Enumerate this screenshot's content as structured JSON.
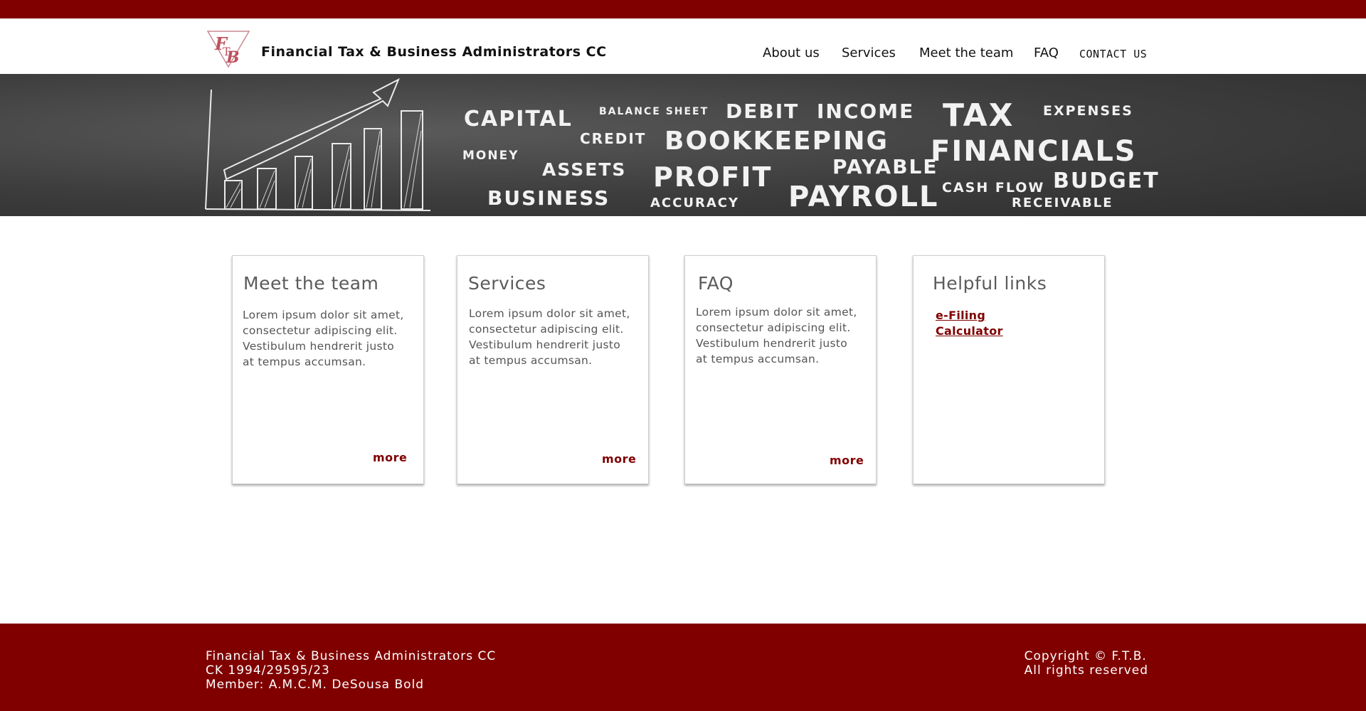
{
  "header": {
    "logo_text": "FTB",
    "brand": "Financial Tax & Business Administrators CC",
    "nav": {
      "about": "About us",
      "services": "Services",
      "team": "Meet the team",
      "faq": "FAQ",
      "contact": "CONTACT US"
    }
  },
  "banner": {
    "words": [
      "CAPITAL",
      "BALANCE SHEET",
      "DEBIT",
      "INCOME",
      "TAX",
      "EXPENSES",
      "CREDIT",
      "BOOKKEEPING",
      "FINANCIALS",
      "MONEY",
      "ASSETS",
      "PROFIT",
      "PAYABLE",
      "BUSINESS",
      "ACCURACY",
      "PAYROLL",
      "CASH FLOW",
      "BUDGET",
      "RECEIVABLE"
    ]
  },
  "cards": [
    {
      "title": "Meet the team",
      "body_lines": [
        "Lorem ipsum dolor sit amet,",
        "consectetur adipiscing elit.",
        "Vestibulum hendrerit justo",
        "at tempus accumsan."
      ],
      "more": "more"
    },
    {
      "title": "Services",
      "body_lines": [
        "Lorem ipsum dolor sit amet,",
        "consectetur adipiscing elit.",
        "Vestibulum hendrerit justo",
        "at tempus accumsan."
      ],
      "more": "more"
    },
    {
      "title": "FAQ",
      "body_lines": [
        "Lorem ipsum dolor sit amet,",
        "consectetur adipiscing elit.",
        "Vestibulum hendrerit justo",
        "at tempus accumsan."
      ],
      "more": "more"
    },
    {
      "title": "Helpful links",
      "links": [
        "e-Filing",
        "Calculator"
      ]
    }
  ],
  "footer": {
    "company": "Financial Tax & Business Administrators CC",
    "reg": "CK 1994/29595/23",
    "member": "Member:  A.M.C.M. DeSousa Bold",
    "copyright": "Copyright © F.T.B.",
    "rights": "All rights reserved"
  },
  "colors": {
    "brand_red": "#800000",
    "banner_dark": "#3d3d3d"
  }
}
